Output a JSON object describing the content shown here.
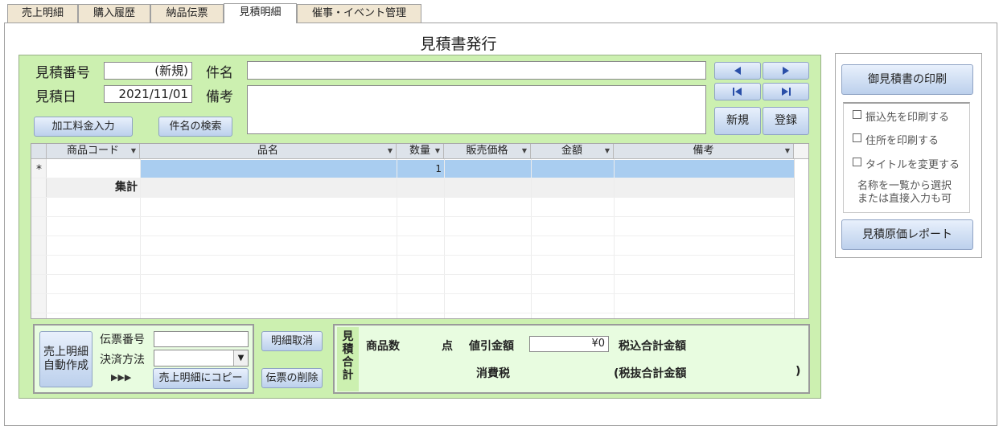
{
  "tabs": [
    "売上明細",
    "購入履歴",
    "納品伝票",
    "見積明細",
    "催事・イベント管理"
  ],
  "active_tab": 3,
  "form_title": "見積書発行",
  "header": {
    "quote_no_label": "見積番号",
    "quote_no_value": "(新規)",
    "subject_label": "件名",
    "subject_value": "",
    "quote_date_label": "見積日",
    "quote_date_value": "2021/11/01",
    "remarks_label": "備考",
    "remarks_value": "",
    "processing_fee_button": "加工料金入力",
    "subject_search_button": "件名の検索",
    "new_button": "新規",
    "register_button": "登録"
  },
  "grid": {
    "columns": [
      "商品コード",
      "品名",
      "数量",
      "販売価格",
      "金額",
      "備考"
    ],
    "new_row_marker": "*",
    "new_row_qty": "1",
    "summary_label": "集計"
  },
  "bottom_left": {
    "auto_create_button_line1": "売上明細",
    "auto_create_button_line2": "自動作成",
    "slip_no_label": "伝票番号",
    "slip_no_value": "",
    "payment_label": "決済方法",
    "payment_value": "",
    "arrows": "▶▶▶",
    "copy_button": "売上明細にコピー",
    "cancel_detail_button": "明細取消",
    "delete_slip_button": "伝票の削除"
  },
  "totals": {
    "vertical_label": [
      "見",
      "積",
      "合",
      "計"
    ],
    "item_count_label": "商品数",
    "item_count_unit": "点",
    "discount_label": "値引金額",
    "discount_value": "¥0",
    "total_incl_label": "税込合計金額",
    "tax_label": "消費税",
    "total_excl_label": "(税抜合計金額",
    "total_excl_close": ")"
  },
  "right_panel": {
    "print_button": "御見積書の印刷",
    "opt_transfer": "振込先を印刷する",
    "opt_address": "住所を印刷する",
    "opt_title": "タイトルを変更する",
    "note_line1": "名称を一覧から選択",
    "note_line2": "または直接入力も可",
    "cost_report_button": "見積原価レポート"
  },
  "colors": {
    "form_bg": "#ccf0b0",
    "selected_row": "#a9cdf0",
    "button": "#bcd0ec",
    "tab_bg": "#f0e6d2"
  }
}
